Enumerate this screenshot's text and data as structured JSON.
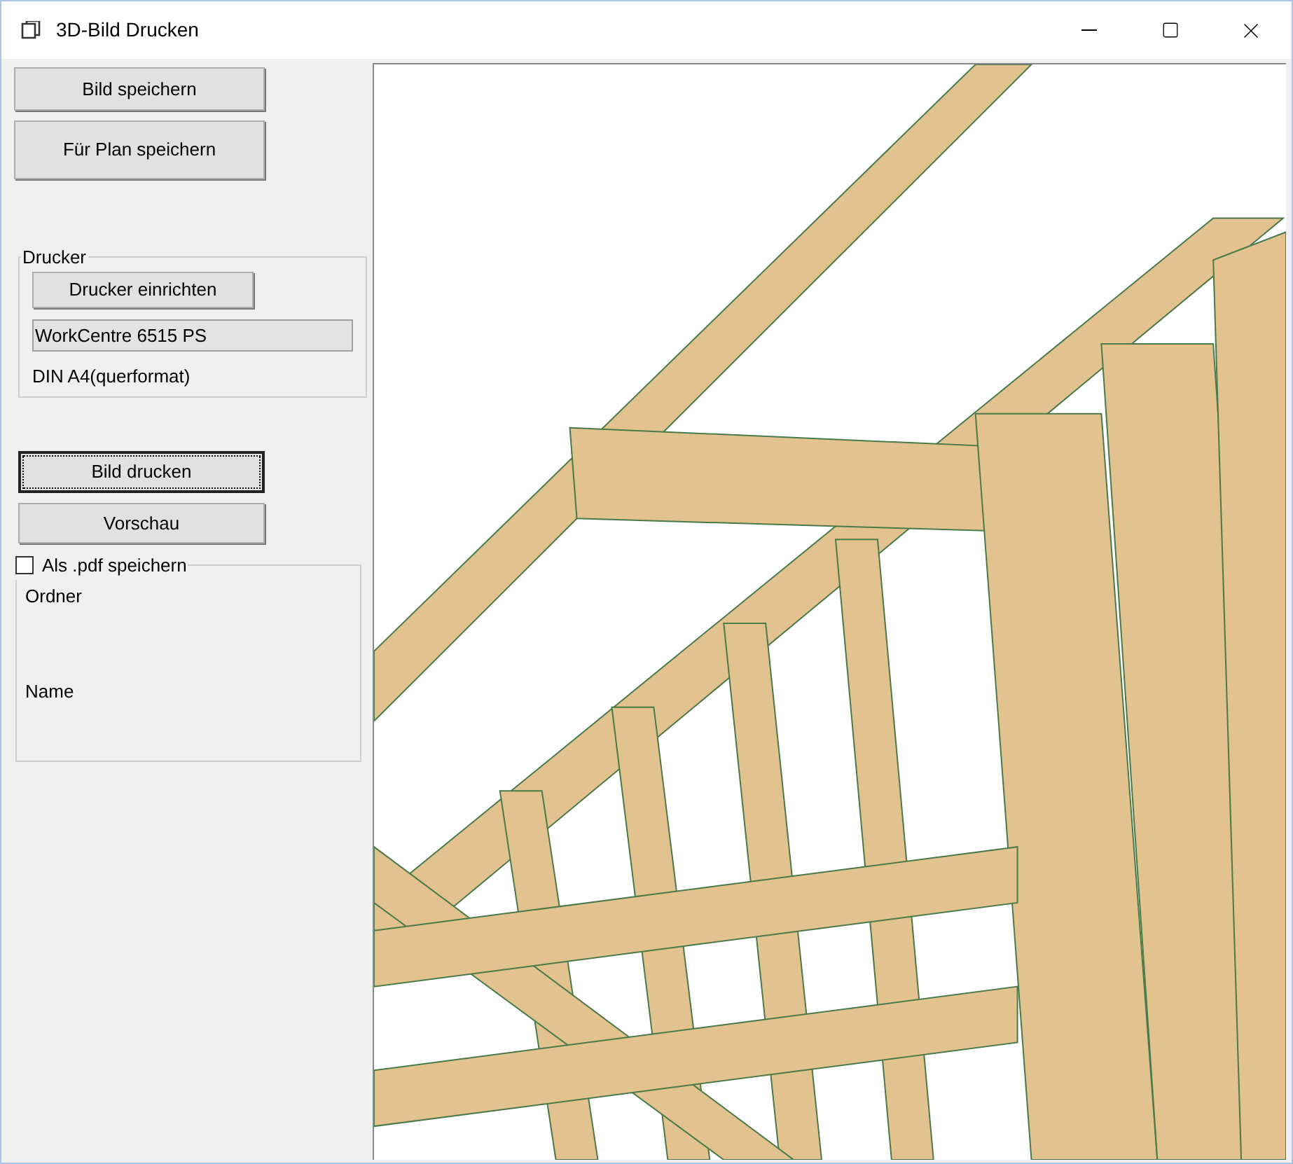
{
  "window": {
    "title": "3D-Bild Drucken"
  },
  "save_buttons": [
    {
      "label": "Bild speichern",
      "focused": false
    },
    {
      "label": "Für Plan speichern",
      "focused": false
    }
  ],
  "printer_group": {
    "legend": "Drucker",
    "setup_button": "Drucker einrichten",
    "printer_name": "WorkCentre 6515 PS",
    "paper": "DIN A4(querformat)"
  },
  "print_buttons": [
    {
      "label": "Bild drucken",
      "focused": true
    },
    {
      "label": "Vorschau",
      "focused": false
    }
  ],
  "pdf_group": {
    "label": "Als .pdf speichern",
    "checked": false,
    "folder_label": "Ordner",
    "name_label": "Name"
  }
}
